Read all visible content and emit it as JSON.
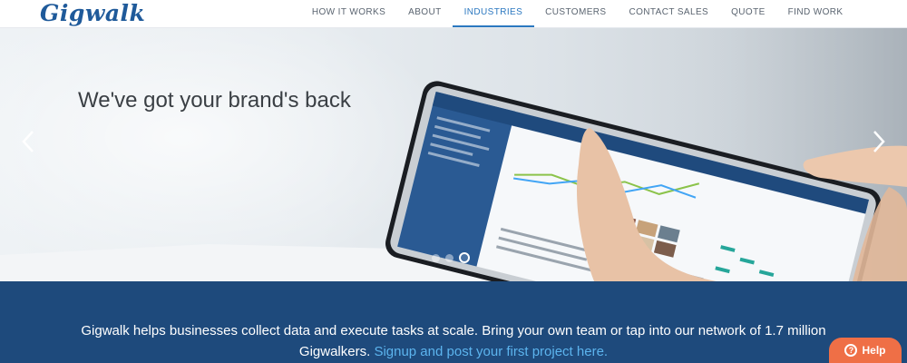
{
  "brand": {
    "logo_text": "Gigwalk"
  },
  "nav": {
    "items": [
      {
        "label": "HOW IT WORKS"
      },
      {
        "label": "ABOUT"
      },
      {
        "label": "INDUSTRIES"
      },
      {
        "label": "CUSTOMERS"
      },
      {
        "label": "CONTACT SALES"
      },
      {
        "label": "QUOTE"
      },
      {
        "label": "FIND WORK"
      }
    ],
    "active": "INDUSTRIES"
  },
  "hero": {
    "headline": "We've got your brand's back",
    "slides_total": 3,
    "active_slide": 3
  },
  "band": {
    "text": "Gigwalk helps businesses collect data and execute tasks at scale. Bring your own team or tap into our network of 1.7 million",
    "text2": "Gigwalkers.",
    "link_text": "Signup and post your first project here."
  },
  "help": {
    "icon": "?",
    "label": "Help"
  },
  "colors": {
    "brand_blue": "#1f5a9a",
    "band": "#1e4a7c",
    "link": "#5cb4ee",
    "help": "#ef6f46"
  }
}
